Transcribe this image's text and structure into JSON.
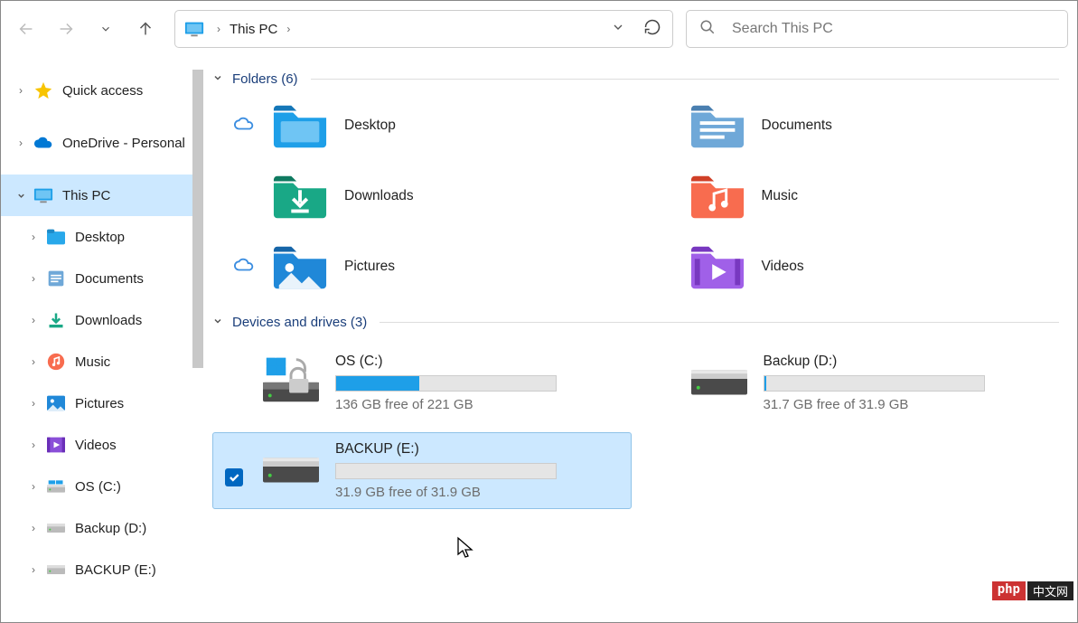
{
  "address": {
    "breadcrumb": "This PC"
  },
  "search": {
    "placeholder": "Search This PC"
  },
  "sidebar": {
    "items": [
      {
        "label": "Quick access"
      },
      {
        "label": "OneDrive - Personal"
      },
      {
        "label": "This PC"
      },
      {
        "label": "Desktop"
      },
      {
        "label": "Documents"
      },
      {
        "label": "Downloads"
      },
      {
        "label": "Music"
      },
      {
        "label": "Pictures"
      },
      {
        "label": "Videos"
      },
      {
        "label": "OS (C:)"
      },
      {
        "label": "Backup (D:)"
      },
      {
        "label": "BACKUP (E:)"
      }
    ]
  },
  "groups": {
    "folders": {
      "title": "Folders",
      "count": "(6)"
    },
    "drives": {
      "title": "Devices and drives",
      "count": "(3)"
    }
  },
  "folders": [
    {
      "label": "Desktop"
    },
    {
      "label": "Documents"
    },
    {
      "label": "Downloads"
    },
    {
      "label": "Music"
    },
    {
      "label": "Pictures"
    },
    {
      "label": "Videos"
    }
  ],
  "drives": [
    {
      "name": "OS (C:)",
      "free": "136 GB free of 221 GB",
      "fill_pct": 38
    },
    {
      "name": "Backup (D:)",
      "free": "31.7 GB free of 31.9 GB",
      "fill_pct": 1
    },
    {
      "name": "BACKUP (E:)",
      "free": "31.9 GB free of 31.9 GB",
      "fill_pct": 0
    }
  ],
  "watermark": {
    "a": "php",
    "b": "中文网"
  }
}
